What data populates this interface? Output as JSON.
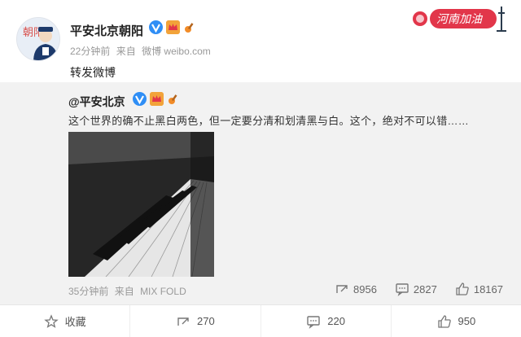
{
  "header": {
    "name": "平安北京朝阳",
    "time": "22分钟前",
    "from_prefix": "来自",
    "source": "微博 weibo.com",
    "text": "转发微博",
    "corner_tag": "河南加油",
    "avatar_label": "朝阳"
  },
  "forward": {
    "name": "@平安北京",
    "text": "这个世界的确不止黑白两色，但一定要分清和划清黑与白。这个，绝对不可以错……",
    "time": "35分钟前",
    "from_prefix": "来自",
    "source": "MIX FOLD",
    "actions": [
      {
        "icon": "share-icon",
        "count": "8956"
      },
      {
        "icon": "comment-icon",
        "count": "2827"
      },
      {
        "icon": "like-icon",
        "count": "18167"
      }
    ]
  },
  "bottom_bar": [
    {
      "icon": "star-icon",
      "label": "收藏"
    },
    {
      "icon": "share-icon",
      "label": "270"
    },
    {
      "icon": "comment-icon",
      "label": "220"
    },
    {
      "icon": "like-icon",
      "label": "950"
    }
  ],
  "colors": {
    "accent": "#2f8ef5",
    "meta": "#999999",
    "forward_bg": "#f2f2f2",
    "tag_red": "#e2364a"
  }
}
